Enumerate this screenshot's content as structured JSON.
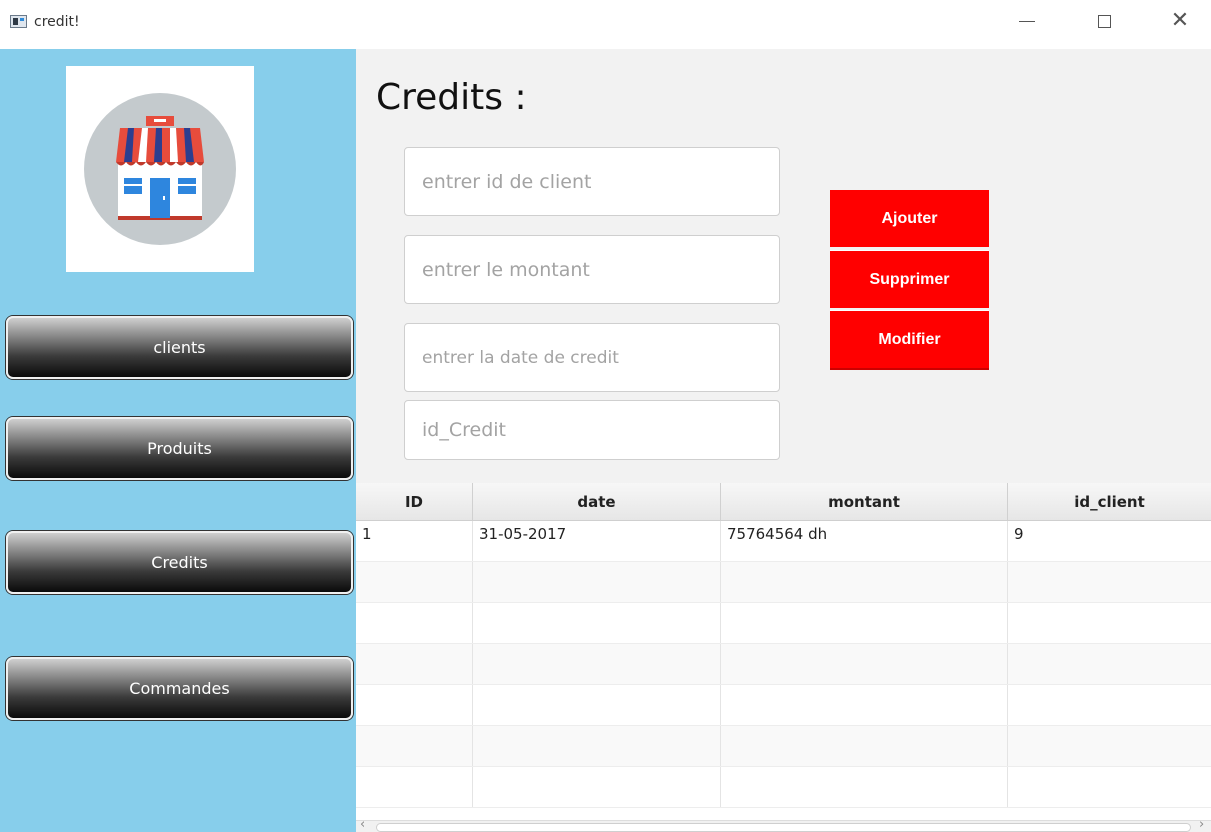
{
  "window": {
    "title": "credit!"
  },
  "sidebar": {
    "nav": [
      {
        "label": "clients"
      },
      {
        "label": "Produits"
      },
      {
        "label": "Credits"
      },
      {
        "label": "Commandes"
      }
    ]
  },
  "main": {
    "title": "Credits :",
    "fields": {
      "client_id_placeholder": "entrer id de client",
      "montant_placeholder": "entrer le montant",
      "date_placeholder": "entrer la date de credit",
      "id_credit_placeholder": "id_Credit"
    },
    "actions": {
      "add": "Ajouter",
      "delete": "Supprimer",
      "edit": "Modifier"
    }
  },
  "table": {
    "columns": [
      "ID",
      "date",
      "montant",
      "id_client"
    ],
    "rows": [
      [
        "1",
        "31-05-2017",
        "75764564 dh",
        "9"
      ]
    ]
  },
  "colors": {
    "sidebar_bg": "#87ceeb",
    "action_red": "#ff0000"
  }
}
